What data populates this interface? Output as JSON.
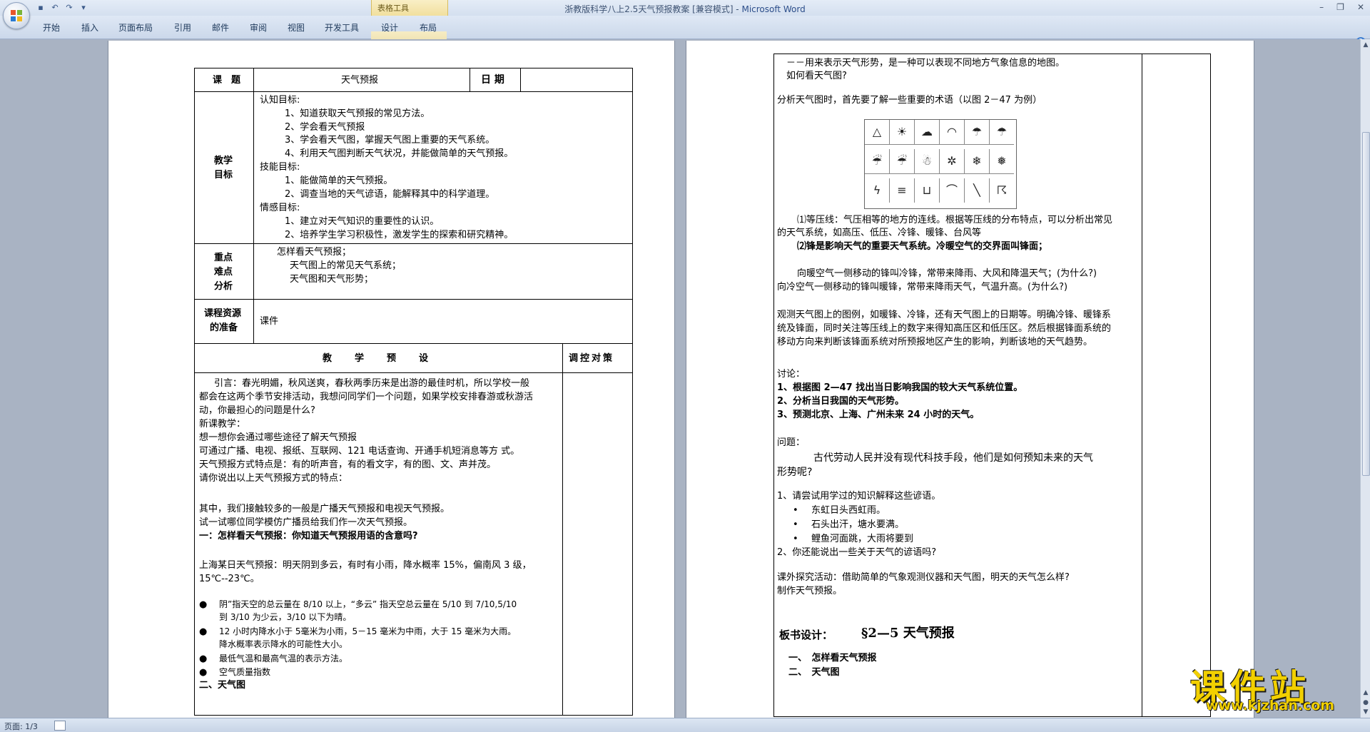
{
  "window": {
    "title": "浙教版科学八上2.5天气预报教案 [兼容模式] - ",
    "app_name": "Microsoft Word",
    "context_tab": "表格工具"
  },
  "ribbon_tabs": [
    "开始",
    "插入",
    "页面布局",
    "引用",
    "邮件",
    "审阅",
    "视图",
    "开发工具",
    "设计",
    "布局"
  ],
  "status": {
    "page": "页面: 1/3"
  },
  "watermark": {
    "main": "课件站",
    "url": "www.kjzhan.com"
  },
  "page1": {
    "topic_label": "课　题",
    "topic_value": "天气预报",
    "date_label": "日 期",
    "goals_label": [
      "教学",
      "目标"
    ],
    "goals": [
      "认知目标:",
      "1、知道获取天气预报的常见方法。",
      "2、学会看天气预报",
      "3、学会看天气图，掌握天气图上重要的天气系统。",
      "4、利用天气图判断天气状况，并能做简单的天气预报。",
      "技能目标:",
      "1、能做简单的天气预报。",
      "2、调查当地的天气谚语，能解释其中的科学道理。",
      "情感目标:",
      "1、建立对天气知识的重要性的认识。",
      "2、培养学生学习积极性，激发学生的探索和研究精神。"
    ],
    "key_label": [
      "重点",
      "难点",
      "分析"
    ],
    "key_points": [
      "怎样看天气预报；",
      "天气图上的常见天气系统；",
      "天气图和天气形势；"
    ],
    "resource_label": [
      "课程资源",
      "的准备"
    ],
    "resource_value": "课件",
    "plan_header": "教　　学　　预　　设",
    "control_header": "调控对策",
    "body": [
      {
        "t": "引言：春光明媚，秋风送爽，春秋两季历来是出游的最佳时机，所以学校一般",
        "b": false
      },
      {
        "t": "都会在这两个季节安排活动，我想问同学们一个问题，如果学校安排春游或秋游活",
        "b": false
      },
      {
        "t": "动，你最担心的问题是什么?",
        "b": false
      },
      {
        "t": "新课教学：",
        "b": false
      },
      {
        "t": "想一想你会通过哪些途径了解天气预报",
        "b": false
      },
      {
        "t": "可通过广播、电视、报纸、互联网、121 电话查询、开通手机短消息等方 式。",
        "b": false
      },
      {
        "t": "天气预报方式特点是：有的听声音，有的看文字，有的图、文、声并茂。",
        "b": false
      },
      {
        "t": "请你说出以上天气预报方式的特点：",
        "b": false
      },
      {
        "t": "",
        "b": false
      },
      {
        "t": "其中，我们接触较多的一般是广播天气预报和电视天气预报。",
        "b": false
      },
      {
        "t": "试一试哪位同学模仿广播员给我们作一次天气预报。",
        "b": false
      },
      {
        "t": "一：怎样看天气预报：你知道天气预报用语的含意吗?",
        "b": true
      },
      {
        "t": "",
        "b": false
      },
      {
        "t": "上海某日天气预报：明天阴到多云，有时有小雨，降水概率 15%，偏南风 3 级，",
        "b": false
      },
      {
        "t": "15℃--23℃。",
        "b": false
      }
    ],
    "bullets": [
      [
        "阴”指天空的总云量在 8/10 以上，“多云” 指天空总云量在 5/10 到 7/10,5/10",
        "到 3/10 为少云，3/10 以下为晴。"
      ],
      [
        "12 小时内降水小于 5毫米为小雨，5－15 毫米为中雨，大于 15 毫米为大雨。",
        "降水概率表示降水的可能性大小。"
      ],
      [
        "最低气温和最高气温的表示方法。"
      ],
      [
        "空气质量指数"
      ]
    ],
    "last_line": "二、天气图"
  },
  "page2": {
    "lines_a": [
      {
        "t": "－－用来表示天气形势，是一种可以表现不同地方气象信息的地图。",
        "b": false
      },
      {
        "t": "如何看天气图?",
        "b": false
      },
      {
        "t": "分析天气图时，首先要了解一些重要的术语（以图 2－47 为例）",
        "b": false
      }
    ],
    "symbols": [
      "△",
      "☀",
      "☁",
      "◠",
      "☂",
      "☂",
      "☔",
      "☔",
      "☃",
      "✲",
      "❄",
      "❅",
      "ϟ",
      "≡",
      "⊔",
      "⌒",
      "╲",
      "☈"
    ],
    "lines_b": [
      "⑴等压线：气压相等的地方的连线。根据等压线的分布特点，可以分析出常见",
      "的天气系统，如高压、低压、冷锋、暖锋、台风等",
      "⑵锋是影响天气的重要天气系统。冷暖空气的交界面叫锋面；",
      "向暖空气一侧移动的锋叫冷锋，常带来降雨、大风和降温天气；(为什么?)",
      "向冷空气一侧移动的锋叫暖锋，常带来降雨天气，气温升高。(为什么?)",
      "观测天气图上的图例，如暖锋、冷锋，还有天气图上的日期等。明确冷锋、暖锋系",
      "统及锋面，同时关注等压线上的数字来得知高压区和低压区。然后根据锋面系统的",
      "移动方向来判断该锋面系统对所预报地区产生的影响，判断该地的天气趋势。",
      "讨论：",
      "1、根据图 2—47 找出当日影响我国的较大天气系统位置。",
      "2、分析当日我国的天气形势。",
      "3、预测北京、上海、广州未来 24 小时的天气。",
      "问题：",
      "古代劳动人民并没有现代科技手段，他们是如何预知未来的天气",
      "形势呢?",
      "1、请尝试用学过的知识解释这些谚语。",
      "东虹日头西虹雨。",
      "石头出汗，塘水要满。",
      "鲤鱼河面跳，大雨将要到",
      "2、你还能说出一些关于天气的谚语吗?",
      "课外探究活动：借助简单的气象观测仪器和天气图，明天的天气怎么样?",
      "制作天气预报。",
      "板书设计：",
      "§2—5 天气预报",
      "一、　怎样看天气预报",
      "二、　天气图"
    ]
  }
}
